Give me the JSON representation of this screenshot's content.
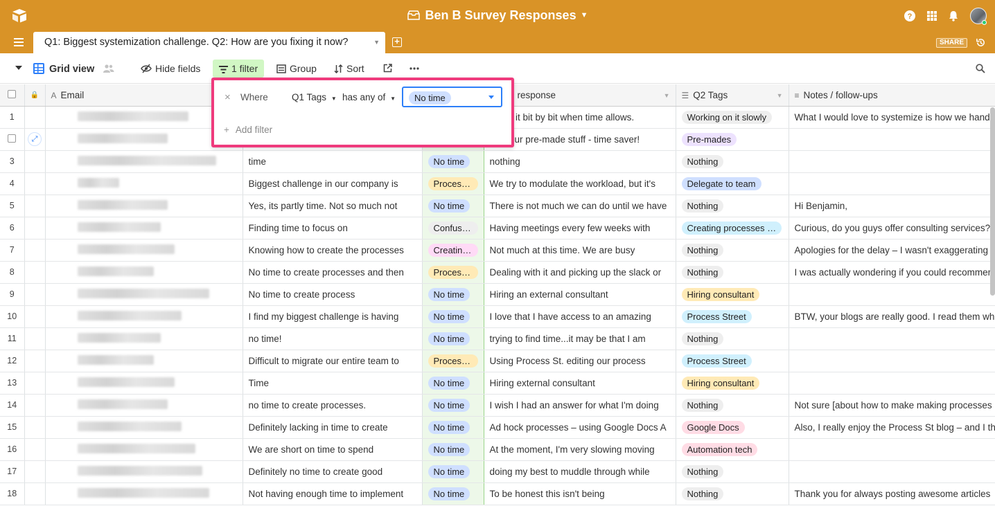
{
  "header": {
    "title": "Ben B Survey Responses",
    "icons": [
      "help-icon",
      "apps-icon",
      "bell-icon",
      "avatar"
    ]
  },
  "tabs": [
    {
      "label": "Q1: Biggest systemization challenge. Q2: How are you fixing it now?"
    }
  ],
  "share_label": "SHARE",
  "toolbar": {
    "view_name": "Grid view",
    "hide_fields": "Hide fields",
    "filter": "1 filter",
    "group": "Group",
    "sort": "Sort"
  },
  "filter_popup": {
    "x": "×",
    "where": "Where",
    "field": "Q1 Tags",
    "operator": "has any of",
    "value": "No time",
    "add_filter": "Add filter"
  },
  "columns": {
    "email": "Email",
    "q1": "",
    "q1_tags": "",
    "q2_response": "response",
    "q2_tags": "Q2 Tags",
    "notes": "Notes / follow-ups"
  },
  "colors": {
    "topbar": "#d99327",
    "accent": "#2d7ff9",
    "filter_active": "#d1f7c4",
    "popup_outline": "#ef3b7d"
  },
  "rows": [
    {
      "n": "1",
      "q1": "",
      "q1tag": "",
      "q1tagColor": "",
      "q2": "ng on it bit by bit when time allows.",
      "q2tag": "Working on it slowly",
      "q2tagColor": "#eeeeee",
      "notes": "What I would love to systemize is how we handle"
    },
    {
      "n": "",
      "q1": "",
      "q1tag": "",
      "q1tagColor": "",
      "q2": "ing your pre-made stuff - time saver!",
      "q2tag": "Pre-mades",
      "q2tagColor": "#ede2fe",
      "notes": ""
    },
    {
      "n": "3",
      "q1": "time",
      "q1tag": "No time",
      "q1tagColor": "#cfdfff",
      "q2": "nothing",
      "q2tag": "Nothing",
      "q2tagColor": "#eeeeee",
      "notes": ""
    },
    {
      "n": "4",
      "q1": "Biggest challenge in our company is",
      "q1tag": "Process …",
      "q1tagColor": "#ffeab6",
      "q2": "We try to modulate the workload, but it's",
      "q2tag": "Delegate to team",
      "q2tagColor": "#cfdfff",
      "notes": ""
    },
    {
      "n": "5",
      "q1": "Yes, its partly time. Not so much not",
      "q1tag": "No time",
      "q1tagColor": "#cfdfff",
      "q2": "There is not much we can do until we have",
      "q2tag": "Nothing",
      "q2tagColor": "#eeeeee",
      "notes": "Hi Benjamin,"
    },
    {
      "n": "6",
      "q1": "Finding time to focus on",
      "q1tag": "Confuse…",
      "q1tagColor": "#eeeeee",
      "q2": "Having meetings every few weeks with",
      "q2tag": "Creating processes …",
      "q2tagColor": "#d0f0fd",
      "notes": "Curious, do you guys offer consulting services?"
    },
    {
      "n": "7",
      "q1": "Knowing how to create the processes",
      "q1tag": "Creating…",
      "q1tagColor": "#ffdaf6",
      "q2": "Not much at this time. We are busy",
      "q2tag": "Nothing",
      "q2tagColor": "#eeeeee",
      "notes": "Apologies for the delay – I wasn't exaggerating w"
    },
    {
      "n": "8",
      "q1": "No time to create processes and then",
      "q1tag": "Process …",
      "q1tagColor": "#ffeab6",
      "q2": "Dealing with it and picking up the slack or",
      "q2tag": "Nothing",
      "q2tagColor": "#eeeeee",
      "notes": "I was actually wondering if you could recommen"
    },
    {
      "n": "9",
      "q1": "No time to create process",
      "q1tag": "No time",
      "q1tagColor": "#cfdfff",
      "q2": "Hiring an external consultant",
      "q2tag": "Hiring consultant",
      "q2tagColor": "#ffeab6",
      "notes": ""
    },
    {
      "n": "10",
      "q1": "I find my biggest challenge is having",
      "q1tag": "No time",
      "q1tagColor": "#cfdfff",
      "q2": "I love that I have access to an amazing",
      "q2tag": "Process Street",
      "q2tagColor": "#d0f0fd",
      "notes": "BTW, your blogs are really good. I read them wh"
    },
    {
      "n": "11",
      "q1": "no time!",
      "q1tag": "No time",
      "q1tagColor": "#cfdfff",
      "q2": "trying to find time...it may be that I am",
      "q2tag": "Nothing",
      "q2tagColor": "#eeeeee",
      "notes": ""
    },
    {
      "n": "12",
      "q1": "Difficult to migrate our entire team to",
      "q1tag": "Process …",
      "q1tagColor": "#ffeab6",
      "q2": "Using Process St. editing our process",
      "q2tag": "Process Street",
      "q2tagColor": "#d0f0fd",
      "notes": ""
    },
    {
      "n": "13",
      "q1": "Time",
      "q1tag": "No time",
      "q1tagColor": "#cfdfff",
      "q2": "Hiring external consultant",
      "q2tag": "Hiring consultant",
      "q2tagColor": "#ffeab6",
      "notes": ""
    },
    {
      "n": "14",
      "q1": "no time to create processes.",
      "q1tag": "No time",
      "q1tagColor": "#cfdfff",
      "q2": "I wish I had an answer for what I'm doing",
      "q2tag": "Nothing",
      "q2tagColor": "#eeeeee",
      "notes": "Not sure [about how to make making processes"
    },
    {
      "n": "15",
      "q1": "Definitely lacking in time to create",
      "q1tag": "No time",
      "q1tagColor": "#cfdfff",
      "q2": "Ad hock processes – using Google Docs A",
      "q2tag": "Google Docs",
      "q2tagColor": "#ffdce5",
      "notes": "Also, I really enjoy the Process St blog – and I th"
    },
    {
      "n": "16",
      "q1": "We are short on time to spend",
      "q1tag": "No time",
      "q1tagColor": "#cfdfff",
      "q2": "At the moment, I'm very slowing moving",
      "q2tag": "Automation tech",
      "q2tagColor": "#ffdce5",
      "notes": ""
    },
    {
      "n": "17",
      "q1": "Definitely no time to create good",
      "q1tag": "No time",
      "q1tagColor": "#cfdfff",
      "q2": "doing my best to muddle through while",
      "q2tag": "Nothing",
      "q2tagColor": "#eeeeee",
      "notes": ""
    },
    {
      "n": "18",
      "q1": "Not having enough time to implement",
      "q1tag": "No time",
      "q1tagColor": "#cfdfff",
      "q2": "To be honest this isn't being",
      "q2tag": "Nothing",
      "q2tagColor": "#eeeeee",
      "notes": "Thank you for always posting awesome articles"
    }
  ]
}
